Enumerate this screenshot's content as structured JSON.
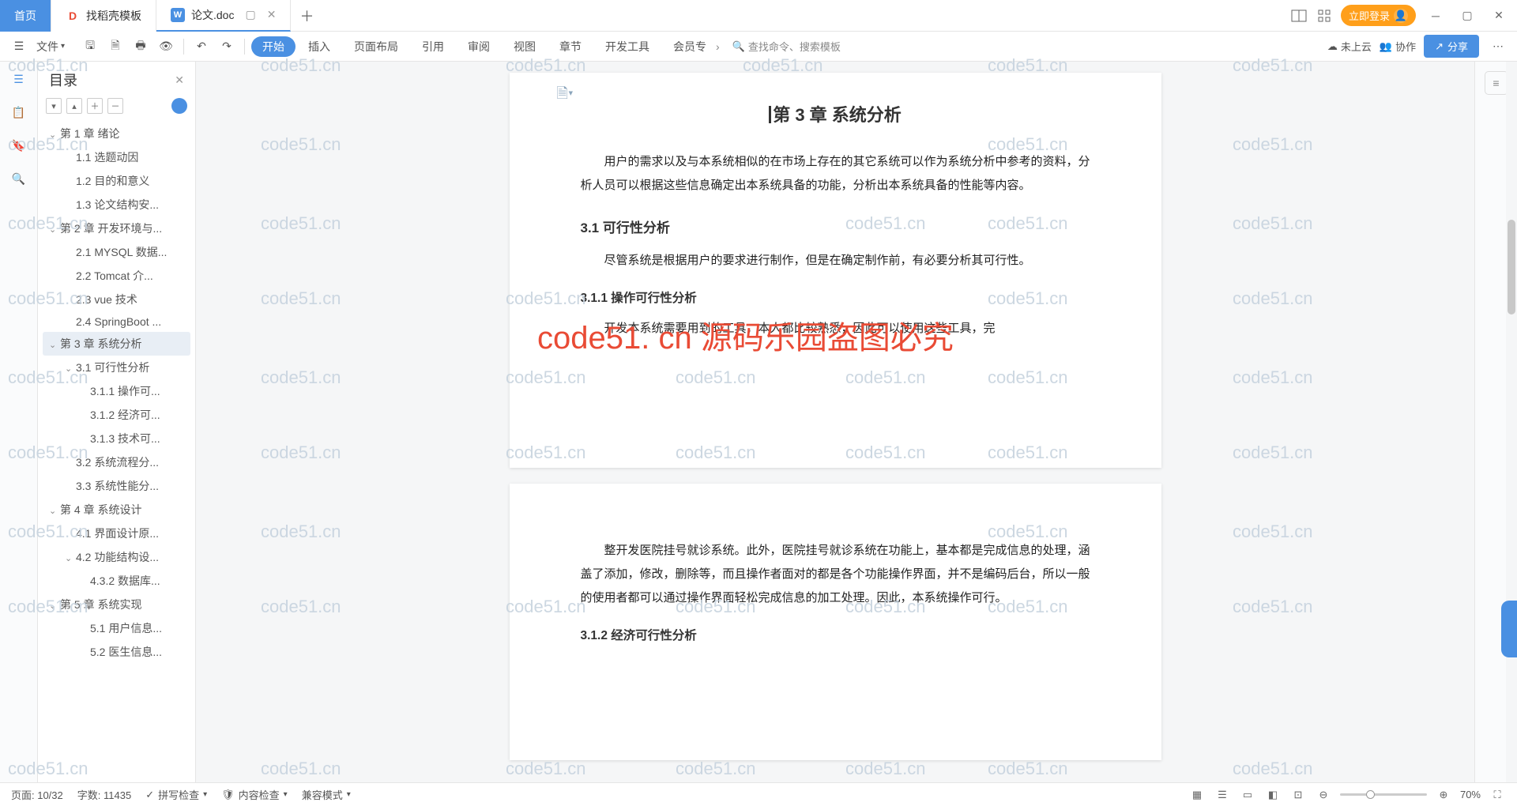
{
  "tabs": {
    "home": "首页",
    "tpl": "找稻壳模板",
    "doc": "论文.doc"
  },
  "titlebar": {
    "login": "立即登录"
  },
  "ribbon": {
    "file": "文件",
    "tabs": [
      "开始",
      "插入",
      "页面布局",
      "引用",
      "审阅",
      "视图",
      "章节",
      "开发工具",
      "会员专"
    ],
    "active": 0,
    "search": "查找命令、搜索模板",
    "cloud": "未上云",
    "collab": "协作",
    "share": "分享"
  },
  "outline": {
    "title": "目录",
    "items": [
      {
        "t": "第 1 章  绪论",
        "l": 0,
        "c": true
      },
      {
        "t": "1.1 选题动因",
        "l": 1
      },
      {
        "t": "1.2 目的和意义",
        "l": 1
      },
      {
        "t": "1.3 论文结构安...",
        "l": 1
      },
      {
        "t": "第 2 章  开发环境与...",
        "l": 0,
        "c": true
      },
      {
        "t": "2.1 MYSQL 数据...",
        "l": 1
      },
      {
        "t": "2.2 Tomcat  介...",
        "l": 1
      },
      {
        "t": "2.3 vue 技术",
        "l": 1
      },
      {
        "t": "2.4 SpringBoot ...",
        "l": 1
      },
      {
        "t": "第 3 章  系统分析",
        "l": 0,
        "c": true,
        "sel": true
      },
      {
        "t": "3.1 可行性分析",
        "l": 1,
        "c": true
      },
      {
        "t": "3.1.1 操作可...",
        "l": 2
      },
      {
        "t": "3.1.2 经济可...",
        "l": 2
      },
      {
        "t": "3.1.3 技术可...",
        "l": 2
      },
      {
        "t": "3.2 系统流程分...",
        "l": 1
      },
      {
        "t": "3.3 系统性能分...",
        "l": 1
      },
      {
        "t": "第 4 章  系统设计",
        "l": 0,
        "c": true
      },
      {
        "t": "4.1 界面设计原...",
        "l": 1
      },
      {
        "t": "4.2 功能结构设...",
        "l": 1,
        "c": true
      },
      {
        "t": "4.3.2  数据库...",
        "l": 2
      },
      {
        "t": "第 5 章  系统实现",
        "l": 0,
        "c": true
      },
      {
        "t": "5.1 用户信息...",
        "l": 2
      },
      {
        "t": "5.2 医生信息...",
        "l": 2
      }
    ]
  },
  "doc": {
    "h2": "第 3 章  系统分析",
    "p1": "用户的需求以及与本系统相似的在市场上存在的其它系统可以作为系统分析中参考的资料，分析人员可以根据这些信息确定出本系统具备的功能，分析出本系统具备的性能等内容。",
    "h3a": "3.1 可行性分析",
    "p2": "尽管系统是根据用户的要求进行制作，但是在确定制作前，有必要分析其可行性。",
    "h4a": "3.1.1 操作可行性分析",
    "p3": "开发本系统需要用到的工具，本人都比较熟悉，因此可以使用这些工具，完",
    "p4": "整开发医院挂号就诊系统。此外，医院挂号就诊系统在功能上，基本都是完成信息的处理，涵盖了添加，修改，删除等，而且操作者面对的都是各个功能操作界面，并不是编码后台，所以一般的使用者都可以通过操作界面轻松完成信息的加工处理。因此，本系统操作可行。",
    "h4b": "3.1.2 经济可行性分析"
  },
  "watermark": "code51. cn 源码乐园盗图必究",
  "wm_small": "code51.cn",
  "status": {
    "page": "页面: 10/32",
    "words": "字数: 11435",
    "spell": "拼写检查",
    "content": "内容检查",
    "compat": "兼容模式",
    "zoom": "70%"
  }
}
